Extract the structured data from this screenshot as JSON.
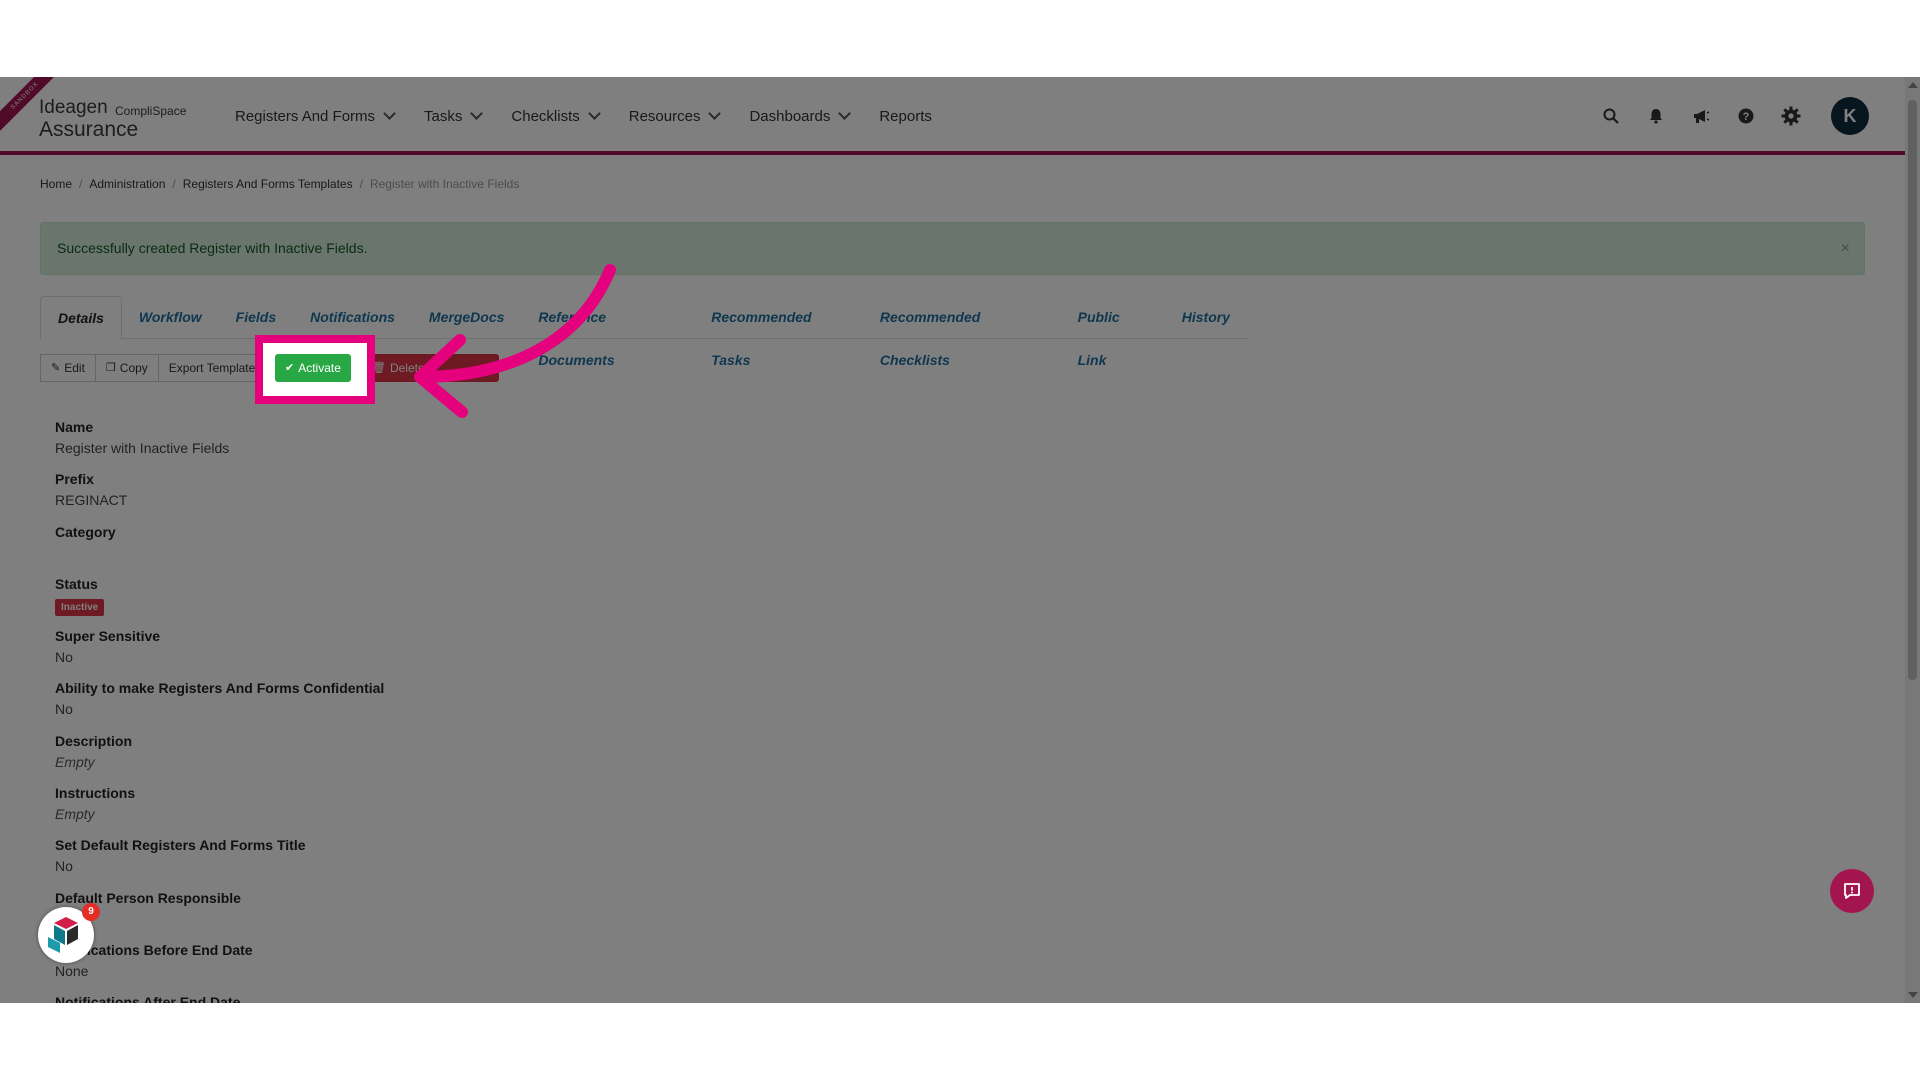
{
  "environment_badge": "SANDBOX",
  "logo": {
    "brand": "Ideagen",
    "product_sub": "CompliSpace",
    "product": "Assurance"
  },
  "nav": [
    {
      "label": "Registers And Forms",
      "dropdown": true
    },
    {
      "label": "Tasks",
      "dropdown": true
    },
    {
      "label": "Checklists",
      "dropdown": true
    },
    {
      "label": "Resources",
      "dropdown": true
    },
    {
      "label": "Dashboards",
      "dropdown": true
    },
    {
      "label": "Reports",
      "dropdown": false
    }
  ],
  "header_icons": [
    "search-icon",
    "bell-icon",
    "megaphone-icon",
    "help-icon",
    "gear-icon"
  ],
  "user": {
    "initial": "K"
  },
  "breadcrumb": [
    "Home",
    "Administration",
    "Registers And Forms Templates",
    "Register with Inactive Fields"
  ],
  "alert": {
    "message": "Successfully created Register with Inactive Fields.",
    "close": "×"
  },
  "tabs": [
    "Details",
    "Workflow",
    "Fields",
    "Notifications",
    "MergeDocs",
    "Reference Documents",
    "Recommended Tasks",
    "Recommended Checklists",
    "Public Link",
    "History"
  ],
  "actions": {
    "edit": "Edit",
    "copy": "Copy",
    "export": "Export Template",
    "activate": "Activate",
    "delete": "Delete"
  },
  "fields": [
    {
      "label": "Name",
      "value": "Register with Inactive Fields"
    },
    {
      "label": "Prefix",
      "value": "REGINACT"
    },
    {
      "label": "Category",
      "value": ""
    },
    {
      "label": "Status",
      "badge": "Inactive"
    },
    {
      "label": "Super Sensitive",
      "value": "No"
    },
    {
      "label": "Ability to make Registers And Forms Confidential",
      "value": "No"
    },
    {
      "label": "Description",
      "value": "Empty",
      "empty": true
    },
    {
      "label": "Instructions",
      "value": "Empty",
      "empty": true
    },
    {
      "label": "Set Default Registers And Forms Title",
      "value": "No"
    },
    {
      "label": "Default Person Responsible",
      "value": ""
    },
    {
      "label": "Notifications Before End Date",
      "value": "None"
    },
    {
      "label": "Notifications After End Date",
      "value": ""
    }
  ],
  "help_widget": {
    "count": "9"
  },
  "colors": {
    "brand": "#a3154f",
    "highlight": "#e5007d",
    "success": "#28a745",
    "danger": "#dc3545",
    "link": "#1f6f9f"
  }
}
